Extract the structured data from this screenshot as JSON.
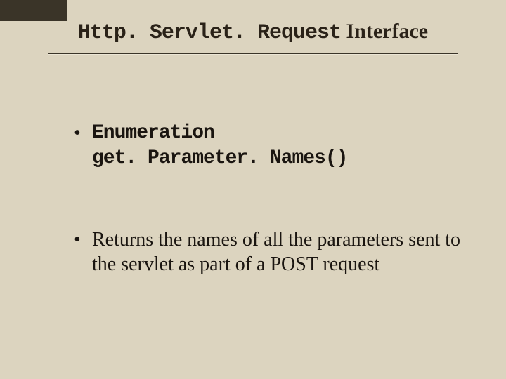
{
  "title": {
    "code_part": "Http. Servlet. Request",
    "serif_part": " Interface"
  },
  "bullet1": {
    "line1": "Enumeration",
    "line2": "get. Parameter. Names()"
  },
  "bullet2": {
    "pre": "Returns the names of all the parameters sent to the servlet as part of a ",
    "code": "POST",
    "post": " request"
  }
}
